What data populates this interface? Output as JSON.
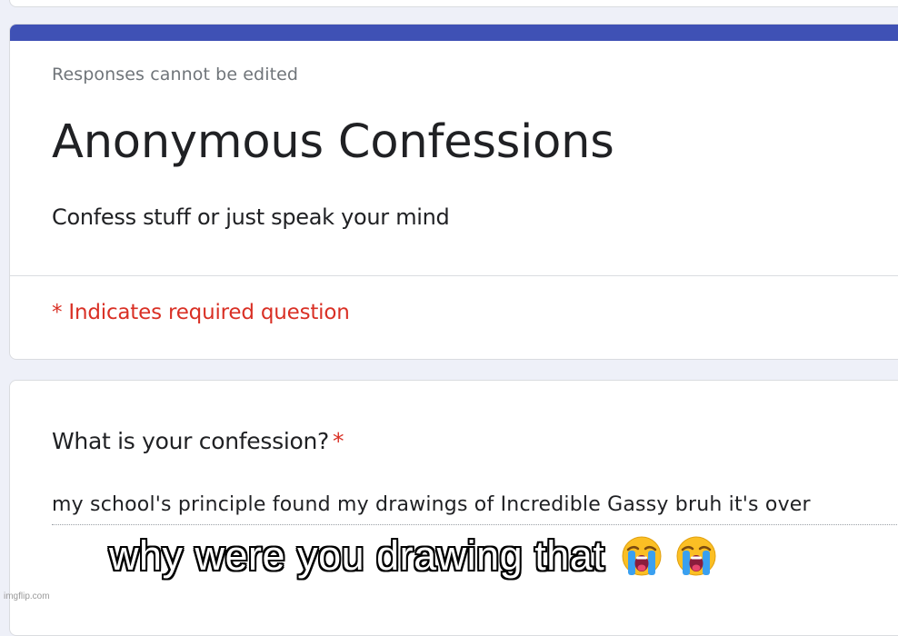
{
  "form": {
    "notice": "Responses cannot be edited",
    "title": "Anonymous Confessions",
    "description": "Confess stuff or just speak your mind",
    "required_note": "* Indicates required question",
    "accent_color": "#3f51b5"
  },
  "question": {
    "label": "What is your confession?",
    "required_marker": "*",
    "answer": "my school's principle found my drawings of Incredible Gassy bruh it's over"
  },
  "meme": {
    "caption": "why were you drawing that",
    "emojis": [
      "loudly-crying-face-icon",
      "loudly-crying-face-icon"
    ]
  },
  "watermark": "imgflip.com"
}
